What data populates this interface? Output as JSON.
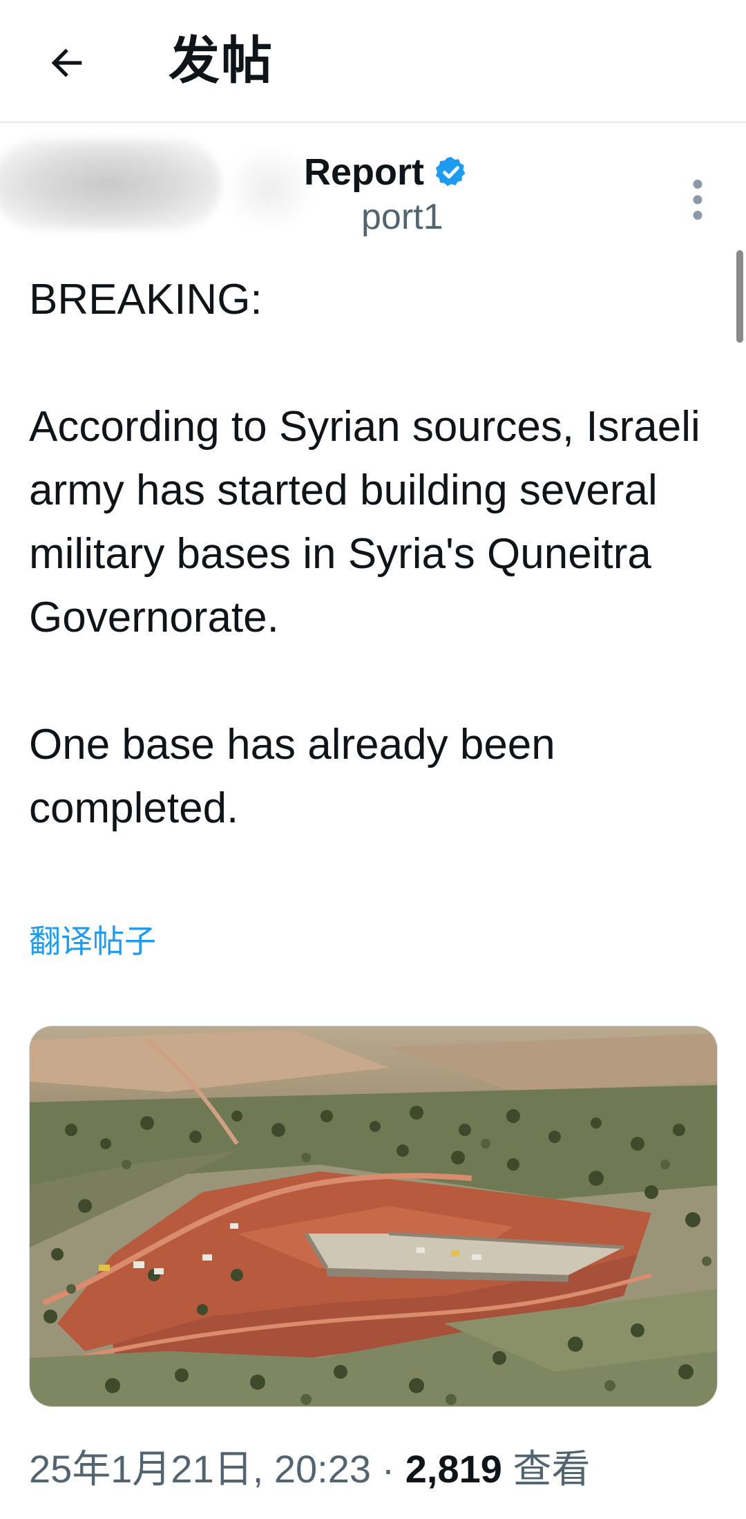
{
  "header": {
    "title": "发帖"
  },
  "author": {
    "name_visible": "Report",
    "handle_visible": "port1"
  },
  "tweet": {
    "paragraphs": [
      "BREAKING:",
      "According to Syrian sources, Israeli army has started building several military bases in Syria's Quneitra Governorate.",
      "One base has already been completed."
    ],
    "translate_label": "翻译帖子"
  },
  "meta": {
    "date": "25年1月21日",
    "time": "20:23",
    "separator": "·",
    "views_count": "2,819",
    "views_label": "查看"
  },
  "icons": {
    "back": "arrow-left-icon",
    "verified": "verified-badge-icon",
    "more": "more-vertical-icon"
  },
  "colors": {
    "accent": "#1d9bf0",
    "text": "#0f1419",
    "secondary": "#536471"
  }
}
